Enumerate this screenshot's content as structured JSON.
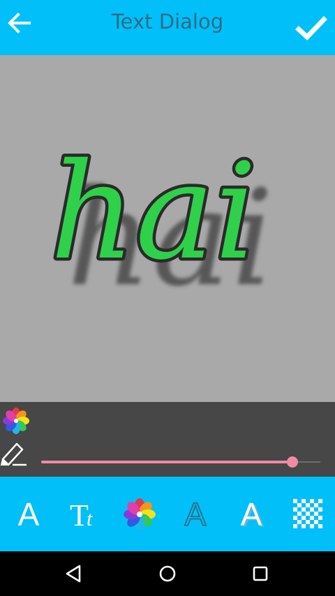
{
  "header": {
    "title": "Text Dialog",
    "back_icon": "arrow-left-icon",
    "confirm_icon": "checkmark-icon"
  },
  "canvas": {
    "text": "hai",
    "fill_color": "#2fd14a",
    "stroke_color": "#2a2a2a",
    "shadow_color": "#4a4a4a",
    "background_color": "#a9a9a9"
  },
  "color_panel": {
    "color_icon": "color-flower-icon",
    "eraser_icon": "highlighter-icon",
    "slider_value": 0.9,
    "slider_color": "#f08aa8"
  },
  "toolbar": {
    "tools": [
      {
        "name": "font-style-icon",
        "glyph": "A"
      },
      {
        "name": "text-size-icon",
        "glyph": "Tt"
      },
      {
        "name": "text-color-icon",
        "glyph": ""
      },
      {
        "name": "text-outline-icon",
        "glyph": "A"
      },
      {
        "name": "text-shadow-icon",
        "glyph": "A"
      },
      {
        "name": "background-pattern-icon",
        "glyph": ""
      }
    ]
  },
  "colors": {
    "accent": "#00bff9",
    "title_text": "#2b6d86",
    "panel": "#474747"
  }
}
